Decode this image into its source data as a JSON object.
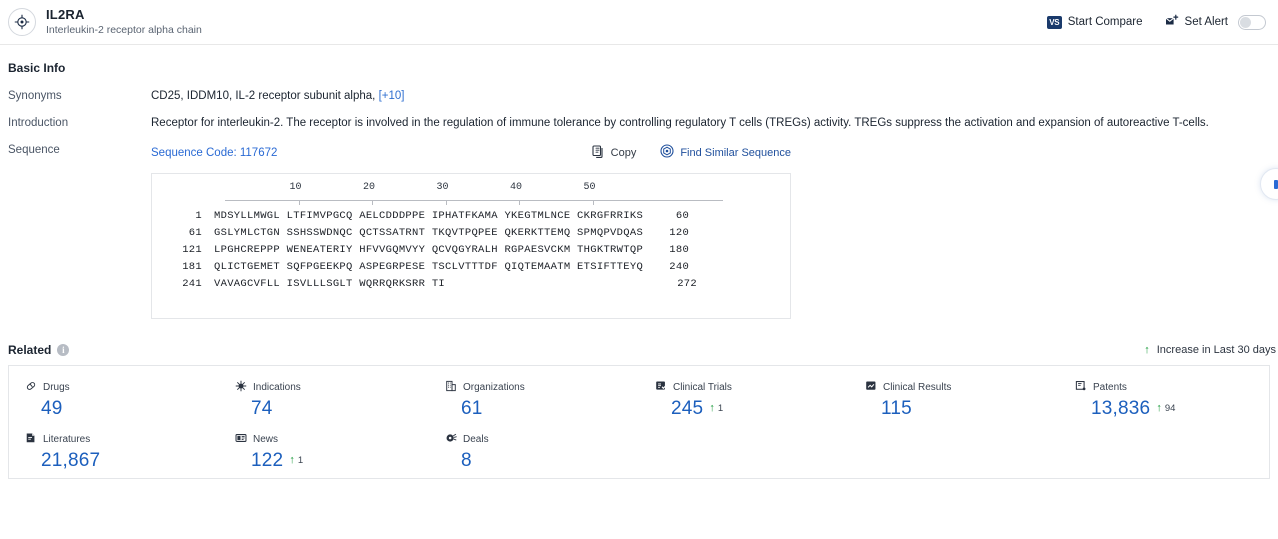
{
  "header": {
    "icon": "target-icon",
    "title": "IL2RA",
    "subtitle": "Interleukin-2 receptor alpha chain",
    "compare_label": "Start Compare",
    "compare_badge": "VS",
    "alert_label": "Set Alert",
    "alert_toggle_state": "off"
  },
  "basic_info": {
    "section_title": "Basic Info",
    "synonyms_label": "Synonyms",
    "synonyms_value": "CD25,  IDDM10,  IL-2 receptor subunit alpha,",
    "synonyms_more": "[+10]",
    "introduction_label": "Introduction",
    "introduction_value": "Receptor for interleukin-2. The receptor is involved in the regulation of immune tolerance by controlling regulatory T cells (TREGs) activity. TREGs suppress the activation and expansion of autoreactive T-cells.",
    "sequence_label": "Sequence",
    "sequence_code": "Sequence Code: 117672",
    "copy_label": "Copy",
    "find_similar_label": "Find Similar Sequence"
  },
  "sequence": {
    "ruler_ticks": [
      "10",
      "20",
      "30",
      "40",
      "50"
    ],
    "rows": [
      {
        "start": "1",
        "chunks": "MDSYLLMWGL LTFIMVPGCQ AELCDDDPPE IPHATFKAMA YKEGTMLNCE CKRGFRRIKS",
        "end": "60"
      },
      {
        "start": "61",
        "chunks": "GSLYMLCTGN SSHSSWDNQC QCTSSATRNT TKQVTPQPEE QKERKTTEMQ SPMQPVDQAS",
        "end": "120"
      },
      {
        "start": "121",
        "chunks": "LPGHCREPPP WENEATERIY HFVVGQMVYY QCVQGYRALH RGPAESVCKM THGKTRWTQP",
        "end": "180"
      },
      {
        "start": "181",
        "chunks": "QLICTGEMET SQFPGEEKPQ ASPEGRPESE TSCLVTTTDF QIQTEMAATM ETSIFTTEYQ",
        "end": "240"
      },
      {
        "start": "241",
        "chunks": "VAVAGCVFLL ISVLLLSGLT WQRRQRKSRR TI",
        "end": "272"
      }
    ]
  },
  "related": {
    "title": "Related",
    "info_icon": "info-icon",
    "legend_label": "Increase in Last 30 days",
    "legend_arrow": "↑",
    "stats": [
      {
        "icon": "pill-icon",
        "label": "Drugs",
        "value": "49",
        "delta": ""
      },
      {
        "icon": "virus-icon",
        "label": "Indications",
        "value": "74",
        "delta": ""
      },
      {
        "icon": "building-icon",
        "label": "Organizations",
        "value": "61",
        "delta": ""
      },
      {
        "icon": "clinical-trial-icon",
        "label": "Clinical Trials",
        "value": "245",
        "delta": "1"
      },
      {
        "icon": "clinical-result-icon",
        "label": "Clinical Results",
        "value": "115",
        "delta": ""
      },
      {
        "icon": "patent-icon",
        "label": "Patents",
        "value": "13,836",
        "delta": "94"
      },
      {
        "icon": "literature-icon",
        "label": "Literatures",
        "value": "21,867",
        "delta": ""
      },
      {
        "icon": "news-icon",
        "label": "News",
        "value": "122",
        "delta": "1"
      },
      {
        "icon": "deals-icon",
        "label": "Deals",
        "value": "8",
        "delta": ""
      }
    ]
  },
  "colors": {
    "accent_blue": "#1c5fbd",
    "link_blue": "#2a6ad4",
    "increase_green": "#1f9d3f"
  }
}
